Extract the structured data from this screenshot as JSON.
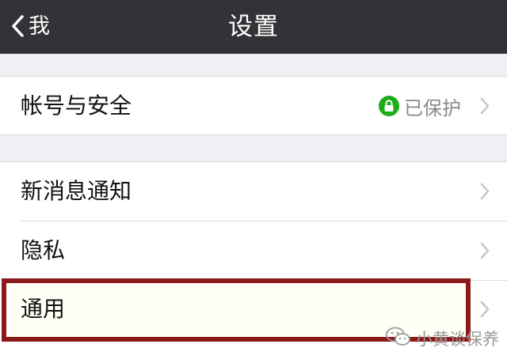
{
  "navbar": {
    "back_label": "我",
    "title": "设置"
  },
  "account": {
    "label": "帐号与安全",
    "status": "已保护"
  },
  "settings_items": [
    {
      "label": "新消息通知"
    },
    {
      "label": "隐私"
    },
    {
      "label": "通用"
    }
  ],
  "highlight": {
    "target": "通用",
    "color": "#8b1a1a"
  },
  "watermark": {
    "text": "小黄谈保养",
    "icon": "wechat-icon"
  },
  "colors": {
    "navbar_bg": "#333337",
    "page_bg": "#efeff4",
    "lock_green": "#1aad19"
  }
}
